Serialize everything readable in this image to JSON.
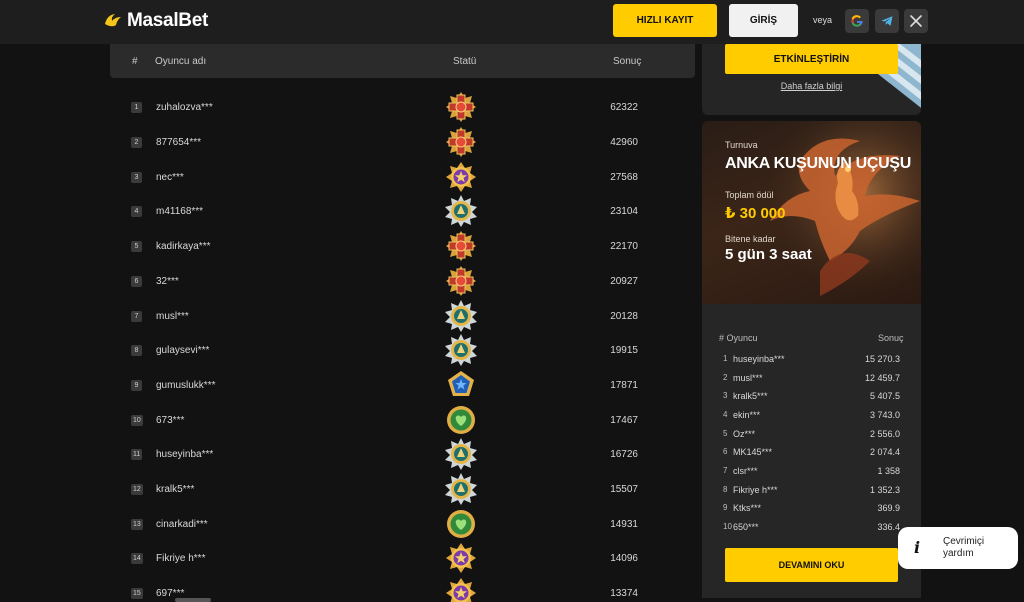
{
  "header": {
    "logo_text": "MasalBet",
    "register_label": "HIZLI KAYIT",
    "login_label": "GİRİŞ",
    "or_label": "veya"
  },
  "leaderboard": {
    "columns": [
      "#",
      "Oyuncu adı",
      "Statü",
      "Sonuç"
    ],
    "rows": [
      {
        "rank": "1",
        "player": "zuhalozva***",
        "medal": "red-cross-medal",
        "score": "62322"
      },
      {
        "rank": "2",
        "player": "877654***",
        "medal": "red-cross-medal",
        "score": "42960"
      },
      {
        "rank": "3",
        "player": "nec***",
        "medal": "purple-star-medal",
        "score": "27568"
      },
      {
        "rank": "4",
        "player": "m41168***",
        "medal": "teal-gold-medal",
        "score": "23104"
      },
      {
        "rank": "5",
        "player": "kadirkaya***",
        "medal": "red-cross-medal",
        "score": "22170"
      },
      {
        "rank": "6",
        "player": "32***",
        "medal": "red-cross-medal",
        "score": "20927"
      },
      {
        "rank": "7",
        "player": "musl***",
        "medal": "teal-gold-medal",
        "score": "20128"
      },
      {
        "rank": "8",
        "player": "gulaysevi***",
        "medal": "teal-gold-medal",
        "score": "19915"
      },
      {
        "rank": "9",
        "player": "gumuslukk***",
        "medal": "blue-pentagon-medal",
        "score": "17871"
      },
      {
        "rank": "10",
        "player": "673***",
        "medal": "green-heart-medal",
        "score": "17467"
      },
      {
        "rank": "11",
        "player": "huseyinba***",
        "medal": "teal-gold-medal",
        "score": "16726"
      },
      {
        "rank": "12",
        "player": "kralk5***",
        "medal": "teal-gold-medal",
        "score": "15507"
      },
      {
        "rank": "13",
        "player": "cinarkadi***",
        "medal": "green-heart-medal",
        "score": "14931"
      },
      {
        "rank": "14",
        "player": "Fikriye h***",
        "medal": "purple-star-medal",
        "score": "14096"
      },
      {
        "rank": "15",
        "player": "697***",
        "medal": "purple-star-medal",
        "score": "13374"
      }
    ]
  },
  "promo": {
    "activate_label": "ETKİNLEŞTİRİN",
    "more_info_label": "Daha fazla bilgi"
  },
  "tournament": {
    "label": "Turnuva",
    "title": "ANKA KUŞUNUN UÇUŞU",
    "prize_label": "Toplam ödül",
    "prize_value": "₺ 30 000",
    "ends_label": "Bitene kadar",
    "ends_value": "5 gün 3 saat"
  },
  "mini_board": {
    "head_left": "# Oyuncu",
    "head_right": "Sonuç",
    "rows": [
      {
        "rank": "1",
        "player": "huseyinba***",
        "score": "15 270.3"
      },
      {
        "rank": "2",
        "player": "musl***",
        "score": "12 459.7"
      },
      {
        "rank": "3",
        "player": "kralk5***",
        "score": "5 407.5"
      },
      {
        "rank": "4",
        "player": "ekin***",
        "score": "3 743.0"
      },
      {
        "rank": "5",
        "player": "Oz***",
        "score": "2 556.0"
      },
      {
        "rank": "6",
        "player": "MK145***",
        "score": "2 074.4"
      },
      {
        "rank": "7",
        "player": "clsr***",
        "score": "1 358"
      },
      {
        "rank": "8",
        "player": "Fikriye h***",
        "score": "1 352.3"
      },
      {
        "rank": "9",
        "player": "Ktks***",
        "score": "369.9"
      },
      {
        "rank": "10",
        "player": "650***",
        "score": "336.4"
      }
    ],
    "read_more_label": "DEVAMINI OKU"
  },
  "help": {
    "icon_text": "i",
    "label": "Çevrimiçi yardım"
  },
  "colors": {
    "accent": "#ffcc00",
    "background": "#121212",
    "panel": "#262626"
  }
}
